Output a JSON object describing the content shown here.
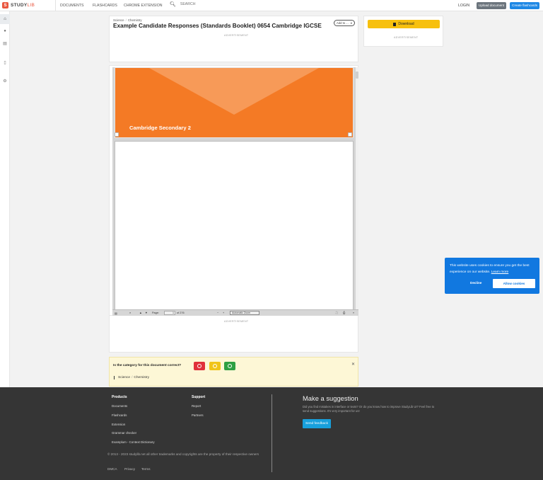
{
  "nav": {
    "logo_letter": "S",
    "logo_bold": "STUDY",
    "logo_light": "LIB",
    "links": [
      "DOCUMENTS",
      "FLASHCARDS",
      "CHROME EXTENSION"
    ],
    "search_placeholder": "SEARCH",
    "login": "LOGIN",
    "upload": "Upload document",
    "create": "Create flashcards"
  },
  "sidebar": {
    "icons": [
      "home-icon",
      "globe-icon",
      "archive-icon",
      "document-icon",
      "gear-icon"
    ]
  },
  "document": {
    "breadcrumb": [
      "Science",
      "Chemistry"
    ],
    "title": "Example Candidate Responses (Standards Booklet) 0654 Cambridge IGCSE",
    "add_to": "Add to ...",
    "advertisement": "ADVERTISEMENT"
  },
  "right_panel": {
    "download": "Download",
    "advertisement": "ADVERTISEMENT"
  },
  "viewer": {
    "cover_text": "Cambridge Secondary 2",
    "page_label": "Page:",
    "page_value": "1",
    "page_total": "of 276",
    "zoom": "Automatic Zoom",
    "advertisement": "ADVERTISEMENT"
  },
  "category": {
    "question": "Is the category for this document correct?",
    "path": [
      "Science",
      "Chemistry"
    ],
    "colors": {
      "no": "#e0303a",
      "unsure": "#f0c419",
      "yes": "#2ea043"
    }
  },
  "cookie": {
    "message": "This website uses cookies to ensure you get the best experience on our website.",
    "learn_more": "Learn more",
    "decline": "Decline",
    "allow": "Allow cookies"
  },
  "footer": {
    "products_title": "Products",
    "products": [
      "Documents",
      "Flashcards",
      "Extension",
      "Grammar checker",
      "Examplum - Context Dictionary"
    ],
    "support_title": "Support",
    "support": [
      "Report",
      "Partners"
    ],
    "copyright": "© 2013 - 2023 studylib.net all other trademarks and copyrights are the property of their respective owners",
    "legal": [
      "DMCA",
      "Privacy",
      "Terms"
    ],
    "suggest_title": "Make a suggestion",
    "suggest_text": "Did you find mistakes in interface or texts? Or do you know how to improve StudyLib UI? Feel free to send suggestions. It's very important for us!",
    "send_feedback": "Send feedback"
  }
}
